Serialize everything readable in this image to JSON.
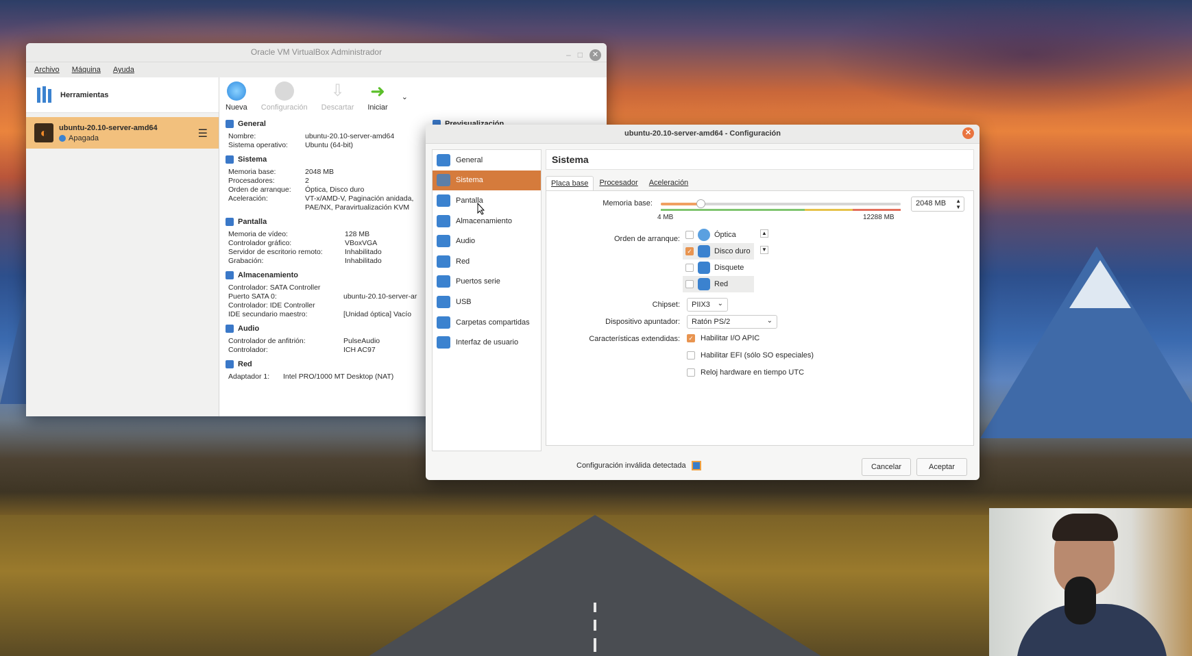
{
  "main_window": {
    "title": "Oracle VM VirtualBox Administrador",
    "menu": [
      "Archivo",
      "Máquina",
      "Ayuda"
    ],
    "tools_label": "Herramientas",
    "vm": {
      "name": "ubuntu-20.10-server-amd64",
      "state": "Apagada"
    },
    "toolbar": {
      "new": "Nueva",
      "settings": "Configuración",
      "discard": "Descartar",
      "start": "Iniciar"
    },
    "preview_title": "Previsualización",
    "sections": {
      "general": {
        "title": "General",
        "rows": [
          [
            "Nombre:",
            "ubuntu-20.10-server-amd64"
          ],
          [
            "Sistema operativo:",
            "Ubuntu (64-bit)"
          ]
        ]
      },
      "system": {
        "title": "Sistema",
        "rows": [
          [
            "Memoria base:",
            "2048 MB"
          ],
          [
            "Procesadores:",
            "2"
          ],
          [
            "Orden de arranque:",
            "Óptica, Disco duro"
          ],
          [
            "Aceleración:",
            "VT-x/AMD-V, Paginación anidada,"
          ],
          [
            "",
            "PAE/NX, Paravirtualización KVM"
          ]
        ]
      },
      "display": {
        "title": "Pantalla",
        "rows": [
          [
            "Memoria de vídeo:",
            "128 MB"
          ],
          [
            "Controlador gráfico:",
            "VBoxVGA"
          ],
          [
            "Servidor de escritorio remoto:",
            "Inhabilitado"
          ],
          [
            "Grabación:",
            "Inhabilitado"
          ]
        ]
      },
      "storage": {
        "title": "Almacenamiento",
        "rows": [
          [
            "Controlador: SATA Controller",
            ""
          ],
          [
            " Puerto SATA 0:",
            "ubuntu-20.10-server-ar"
          ],
          [
            "Controlador: IDE Controller",
            ""
          ],
          [
            " IDE secundario maestro:",
            "[Unidad óptica] Vacío"
          ]
        ]
      },
      "audio": {
        "title": "Audio",
        "rows": [
          [
            "Controlador de anfitrión:",
            "PulseAudio"
          ],
          [
            "Controlador:",
            "ICH AC97"
          ]
        ]
      },
      "network": {
        "title": "Red",
        "rows": [
          [
            "Adaptador 1:",
            "Intel PRO/1000 MT Desktop (NAT)"
          ]
        ]
      }
    }
  },
  "config_dialog": {
    "title": "ubuntu-20.10-server-amd64 - Configuración",
    "nav": [
      "General",
      "Sistema",
      "Pantalla",
      "Almacenamiento",
      "Audio",
      "Red",
      "Puertos serie",
      "USB",
      "Carpetas compartidas",
      "Interfaz de usuario"
    ],
    "selected_nav": "Sistema",
    "page_title": "Sistema",
    "tabs": [
      "Placa base",
      "Procesador",
      "Aceleración"
    ],
    "active_tab": "Placa base",
    "memory": {
      "label": "Memoria base:",
      "value": "2048 MB",
      "min": "4 MB",
      "max": "12288 MB",
      "fraction": 0.167
    },
    "boot_order": {
      "label": "Orden de arranque:",
      "items": [
        {
          "name": "Óptica",
          "checked": false
        },
        {
          "name": "Disco duro",
          "checked": true
        },
        {
          "name": "Disquete",
          "checked": false
        },
        {
          "name": "Red",
          "checked": false
        }
      ]
    },
    "chipset": {
      "label": "Chipset:",
      "value": "PIIX3"
    },
    "pointing": {
      "label": "Dispositivo apuntador:",
      "value": "Ratón PS/2"
    },
    "extended": {
      "label": "Características extendidas:",
      "options": [
        {
          "label": "Habilitar I/O APIC",
          "checked": true
        },
        {
          "label": "Habilitar EFI (sólo SO especiales)",
          "checked": false
        },
        {
          "label": "Reloj hardware en tiempo UTC",
          "checked": false
        }
      ]
    },
    "footer": {
      "warning": "Configuración inválida detectada",
      "cancel": "Cancelar",
      "accept": "Aceptar"
    }
  },
  "colors": {
    "selection": "#d57b3c",
    "vm_highlight": "#f2c07d",
    "accent_blue": "#3b82cf",
    "start_green": "#5bbf2a"
  }
}
